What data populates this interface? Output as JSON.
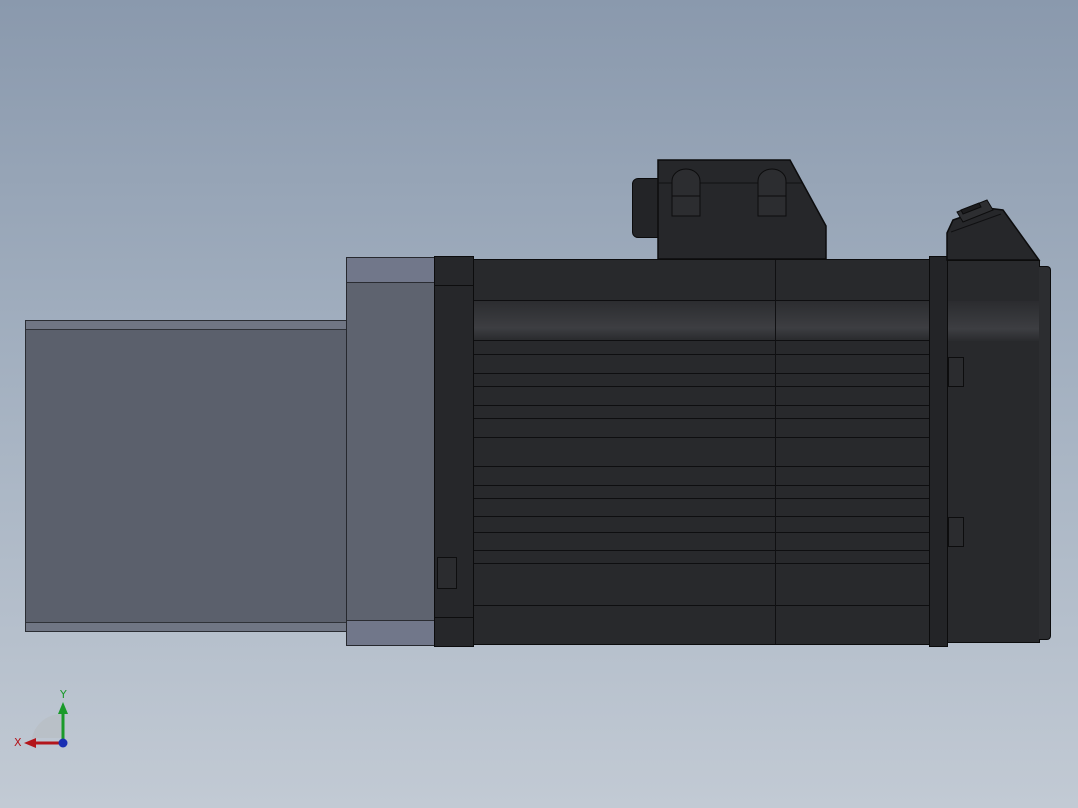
{
  "viewport": {
    "background_top": "#8a99ad",
    "background_bottom": "#c2cad4",
    "model": "servo-gearmotor-side-view"
  },
  "triad": {
    "x_label": "X",
    "y_label": "Y",
    "x_color": "#b3151b",
    "y_color": "#1a9a2a",
    "z_color": "#1a2fb3"
  },
  "colors": {
    "motor_black": "#28292c",
    "gearbox_gray": "#5b606c"
  }
}
